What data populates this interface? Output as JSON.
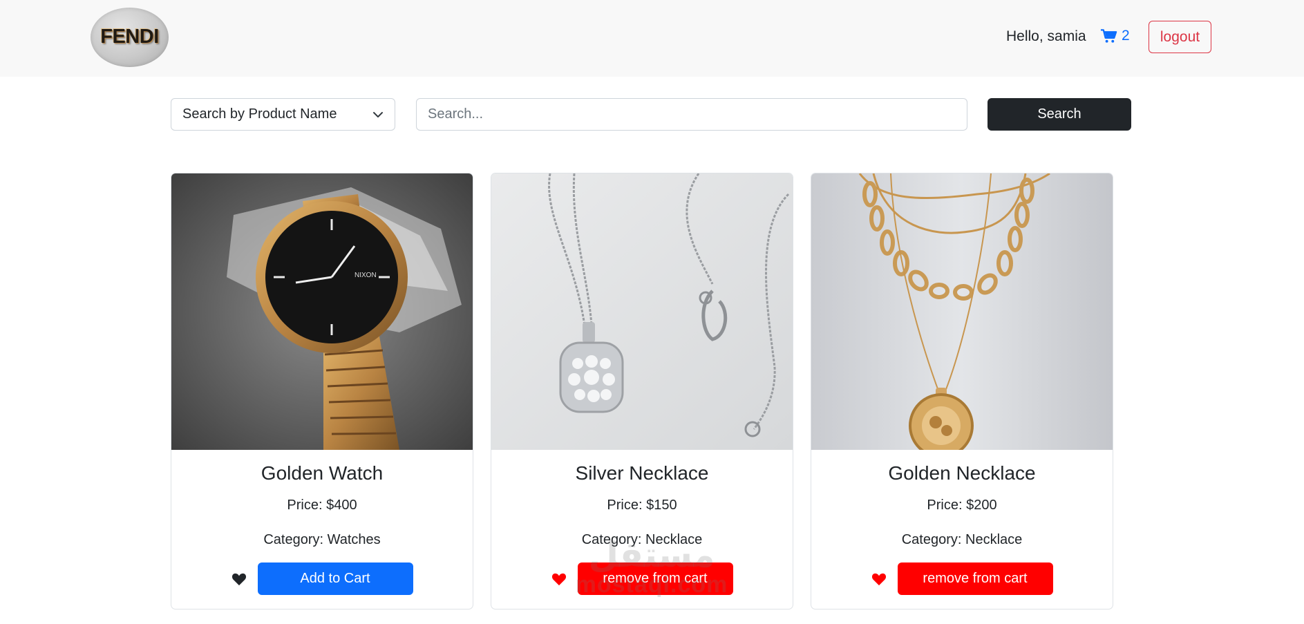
{
  "navbar": {
    "logo_text": "FENDI",
    "greeting": "Hello, samia",
    "cart_count": "2",
    "cart_icon": "shopping-cart-icon",
    "logout_label": "logout"
  },
  "search": {
    "filter_selected": "Search by Product Name",
    "input_placeholder": "Search...",
    "input_value": "",
    "button_label": "Search"
  },
  "products": [
    {
      "title": "Golden Watch",
      "price": "Price: $400",
      "category": "Category: Watches",
      "button_label": "Add to Cart",
      "favorite": false
    },
    {
      "title": "Silver Necklace",
      "price": "Price: $150",
      "category": "Category: Necklace",
      "button_label": "remove from cart",
      "favorite": true
    },
    {
      "title": "Golden Necklace",
      "price": "Price: $200",
      "category": "Category: Necklace",
      "button_label": "remove from cart",
      "favorite": true
    }
  ],
  "watermark": {
    "arabic": "مستقل",
    "latin": "mostaql.com"
  },
  "colors": {
    "primary": "#0d6efd",
    "danger": "#ff0000",
    "outline_danger": "#dc3545",
    "dark": "#212529",
    "navbar_bg": "#f8f8f8"
  }
}
